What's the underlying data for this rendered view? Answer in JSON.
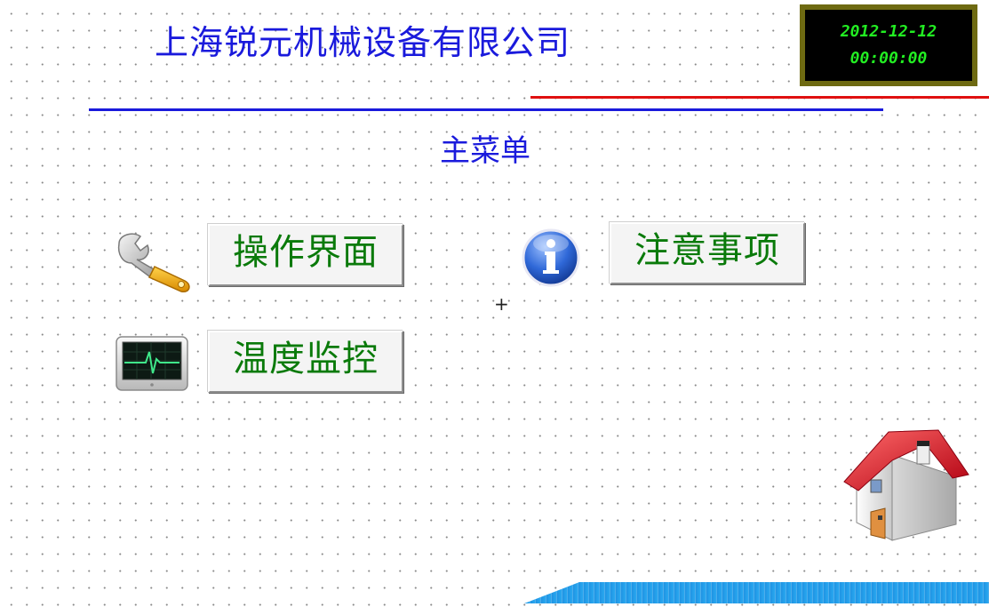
{
  "header": {
    "company_name": "上海锐元机械设备有限公司",
    "clock_date": "2012-12-12",
    "clock_time": "00:00:00"
  },
  "menu": {
    "title": "主菜单",
    "buttons": [
      {
        "label": "操作界面",
        "icon": "wrench-icon"
      },
      {
        "label": "注意事项",
        "icon": "info-icon"
      },
      {
        "label": "温度监控",
        "icon": "monitor-icon"
      }
    ]
  },
  "home_icon": "home-icon",
  "colors": {
    "title_blue": "#1a1adc",
    "button_text_green": "#0a7a0a",
    "clock_text_green": "#22ee22",
    "clock_border": "#6e6a12",
    "red_line": "#e01010"
  }
}
